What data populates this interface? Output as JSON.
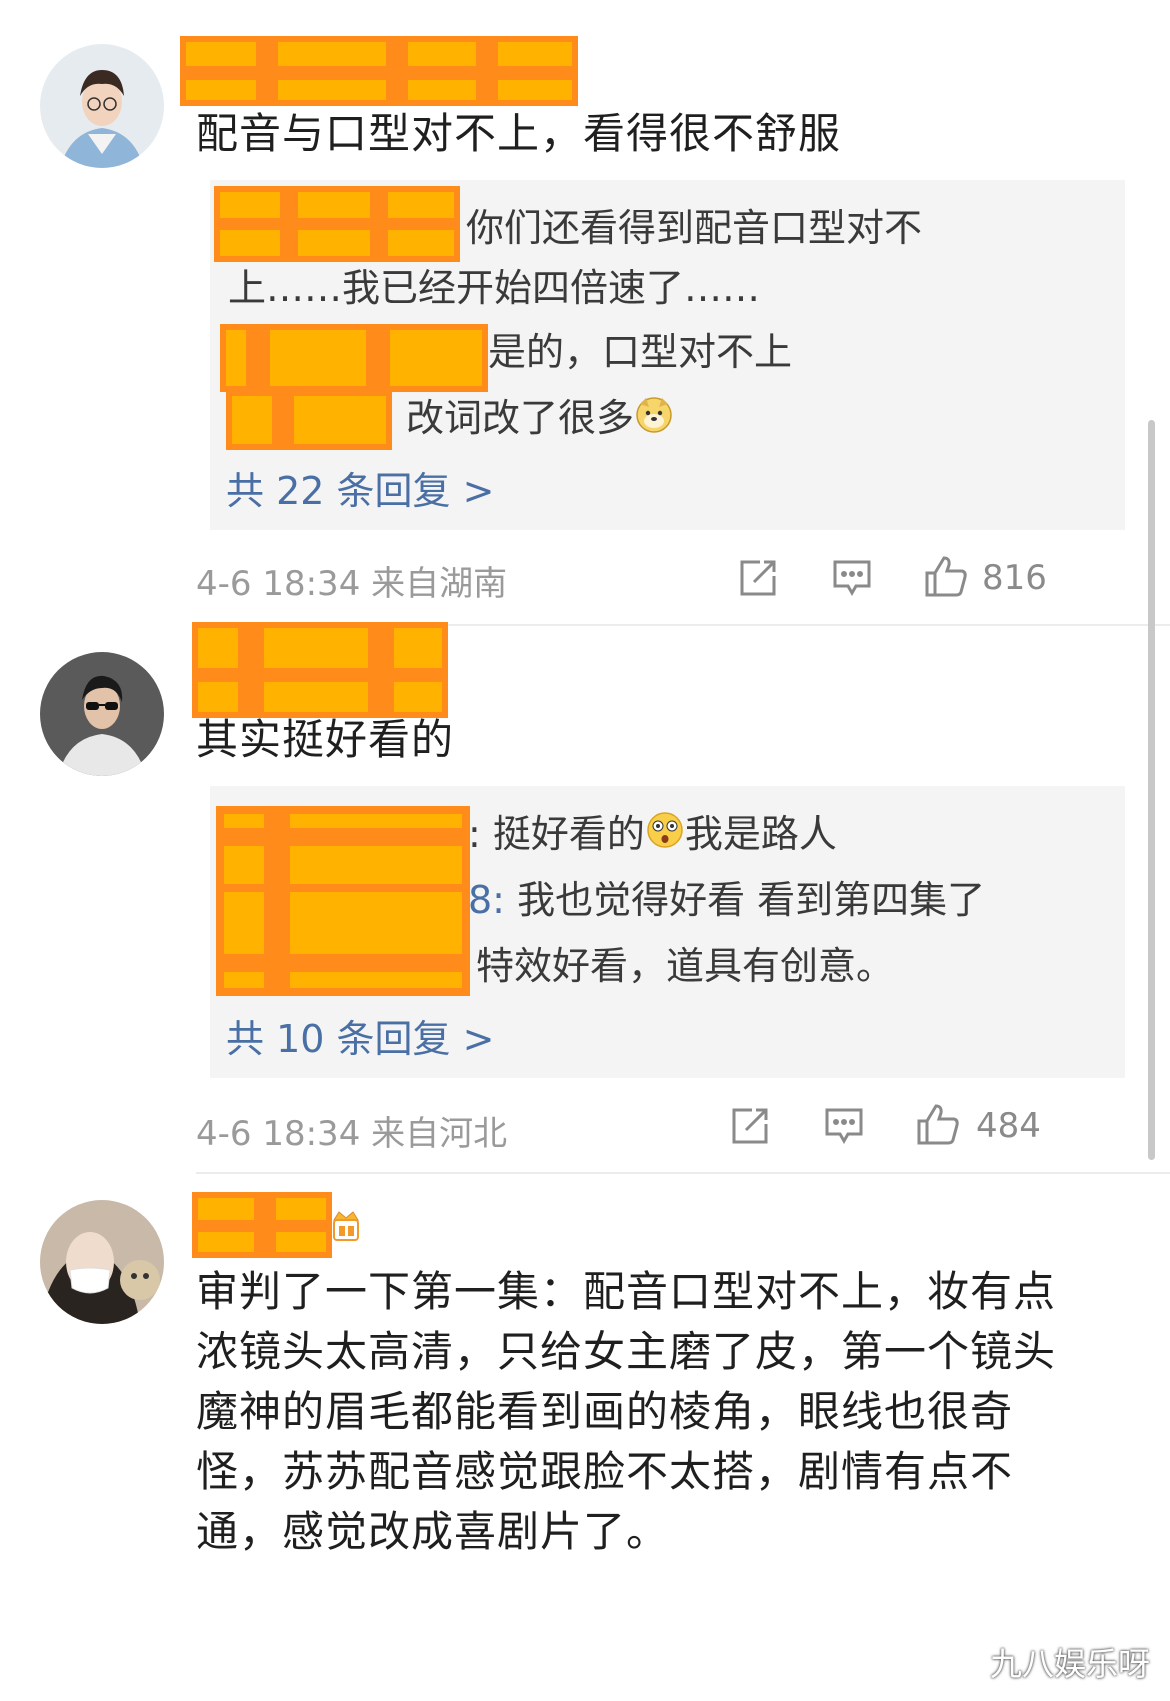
{
  "colors": {
    "link": "#4a6fa5",
    "meta_text": "#9a9a9a",
    "reply_bg": "#f4f4f4",
    "redaction_orange": "#ff8c1a",
    "redaction_yellow": "#ffb300"
  },
  "comments": [
    {
      "text": "配音与口型对不上，看得很不舒服",
      "replies": [
        {
          "text_line1": "你们还看得到配音口型对不",
          "text_line2": "上……我已经开始四倍速了……"
        },
        {
          "text": "是的，口型对不上"
        },
        {
          "text": "改词改了很多",
          "emoji": "doge-emoji"
        }
      ],
      "reply_link": "共 22 条回复 >",
      "timestamp": "4-6 18:34",
      "source": "来自湖南",
      "likes": "816"
    },
    {
      "text": "其实挺好看的",
      "replies": [
        {
          "prefix": ":",
          "text": "挺好看的",
          "emoji": "surprised-emoji",
          "text2": "我是路人"
        },
        {
          "prefix": "8:",
          "text": "我也觉得好看 看到第四集了"
        },
        {
          "text": "特效好看，道具有创意。"
        }
      ],
      "reply_link": "共 10 条回复 >",
      "timestamp": "4-6 18:34",
      "source": "来自河北",
      "likes": "484"
    },
    {
      "text_lines": [
        "审判了一下第一集：配音口型对不上，妆有点",
        "浓镜头太高清，只给女主磨了皮，第一个镜头",
        "魔神的眉毛都能看到画的棱角，眼线也很奇",
        "怪，苏苏配音感觉跟脸不太搭，剧情有点不",
        "通，感觉改成喜剧片了。"
      ],
      "badge_icon": "crown-badge-icon"
    }
  ],
  "watermark": "九八娱乐呀"
}
